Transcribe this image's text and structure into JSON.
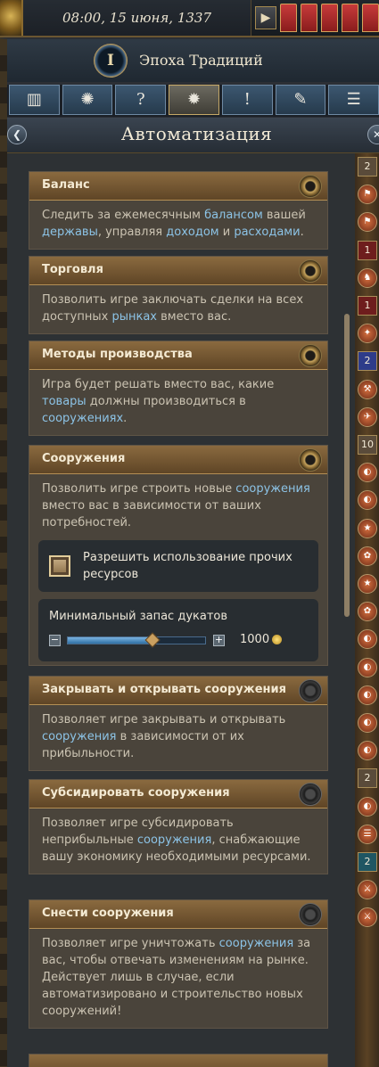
{
  "topbar": {
    "date": "08:00, 15 июня, 1337",
    "play_icon": "▶"
  },
  "header": {
    "emblem_letter": "I",
    "title": "Эпоха Традиций"
  },
  "tabs": [
    {
      "name": "stats",
      "icon": "▥"
    },
    {
      "name": "search",
      "icon": "✺"
    },
    {
      "name": "help",
      "icon": "?"
    },
    {
      "name": "automation",
      "icon": "✹"
    },
    {
      "name": "info",
      "icon": "!"
    },
    {
      "name": "quill",
      "icon": "✎"
    },
    {
      "name": "list",
      "icon": "☰"
    }
  ],
  "section": {
    "title": "Автоматизация",
    "back_icon": "❮",
    "close_icon": "✕"
  },
  "cards": {
    "balance": {
      "title": "Баланс",
      "p1": "Следить за ежемесячным ",
      "h1": "балансом",
      "p2": " вашей ",
      "h2": "державы",
      "p3": ", управляя ",
      "h3": "доходом",
      "p4": " и ",
      "h4": "расходами",
      "p5": "."
    },
    "trade": {
      "title": "Торговля",
      "p1": "Позволить игре заключать сделки на всех доступных ",
      "h1": "рынках",
      "p2": " вместо вас."
    },
    "methods": {
      "title": "Методы производства",
      "p1": "Игра будет решать вместо вас, какие ",
      "h1": "товары",
      "p2": " должны производиться в ",
      "h2": "сооружениях",
      "p3": "."
    },
    "buildings": {
      "title": "Сооружения",
      "p1": "Позволить игре строить новые ",
      "h1": "сооружения",
      "p2": " вместо вас в зависимости от ваших потребностей.",
      "checkbox_label": "Разрешить использование прочих ресурсов",
      "min_label": "Минимальный запас дукатов",
      "min_value": "1000",
      "slider_fraction": 0.62
    },
    "close_open": {
      "title": "Закрывать и открывать сооружения",
      "p1": "Позволяет игре закрывать и открывать ",
      "h1": "сооружения",
      "p2": " в зависимости от их прибыльности."
    },
    "subsidize": {
      "title": "Субсидировать сооружения",
      "p1": "Позволяет игре субсидировать неприбыльные ",
      "h1": "сооружения",
      "p2": ", снабжающие вашу экономику необходимыми ресурсами."
    },
    "demolish": {
      "title": "Снести сооружения",
      "p1": "Позволяет игре уничтожать ",
      "h1": "сооружения",
      "p2": " за вас, чтобы отвечать изменениям на рынке. Действует лишь в случае, если автоматизировано и строительство новых сооружений!"
    }
  },
  "strip": [
    {
      "kind": "chip",
      "style": "brown",
      "text": "2"
    },
    {
      "kind": "icon",
      "text": "⚑"
    },
    {
      "kind": "icon",
      "text": "⚑"
    },
    {
      "kind": "chip",
      "style": "red",
      "text": "1"
    },
    {
      "kind": "icon",
      "text": "♞"
    },
    {
      "kind": "chip",
      "style": "red",
      "text": "1"
    },
    {
      "kind": "icon",
      "text": "✦"
    },
    {
      "kind": "chip",
      "style": "blue",
      "text": "2"
    },
    {
      "kind": "icon",
      "text": "⚒"
    },
    {
      "kind": "icon",
      "text": "✈"
    },
    {
      "kind": "chip",
      "style": "brown",
      "text": "10"
    },
    {
      "kind": "icon",
      "text": "◐"
    },
    {
      "kind": "icon",
      "text": "◐"
    },
    {
      "kind": "icon",
      "text": "★"
    },
    {
      "kind": "icon",
      "text": "✿"
    },
    {
      "kind": "icon",
      "text": "★"
    },
    {
      "kind": "icon",
      "text": "✿"
    },
    {
      "kind": "icon",
      "text": "◐"
    },
    {
      "kind": "icon",
      "text": "◐"
    },
    {
      "kind": "icon",
      "text": "◐"
    },
    {
      "kind": "icon",
      "text": "◐"
    },
    {
      "kind": "icon",
      "text": "◐"
    },
    {
      "kind": "chip",
      "style": "brown",
      "text": "2"
    },
    {
      "kind": "icon",
      "text": "◐"
    },
    {
      "kind": "icon",
      "text": "☰"
    },
    {
      "kind": "chip",
      "style": "teal",
      "text": "2"
    },
    {
      "kind": "icon",
      "text": "⚔"
    },
    {
      "kind": "icon",
      "text": "⚔"
    }
  ]
}
